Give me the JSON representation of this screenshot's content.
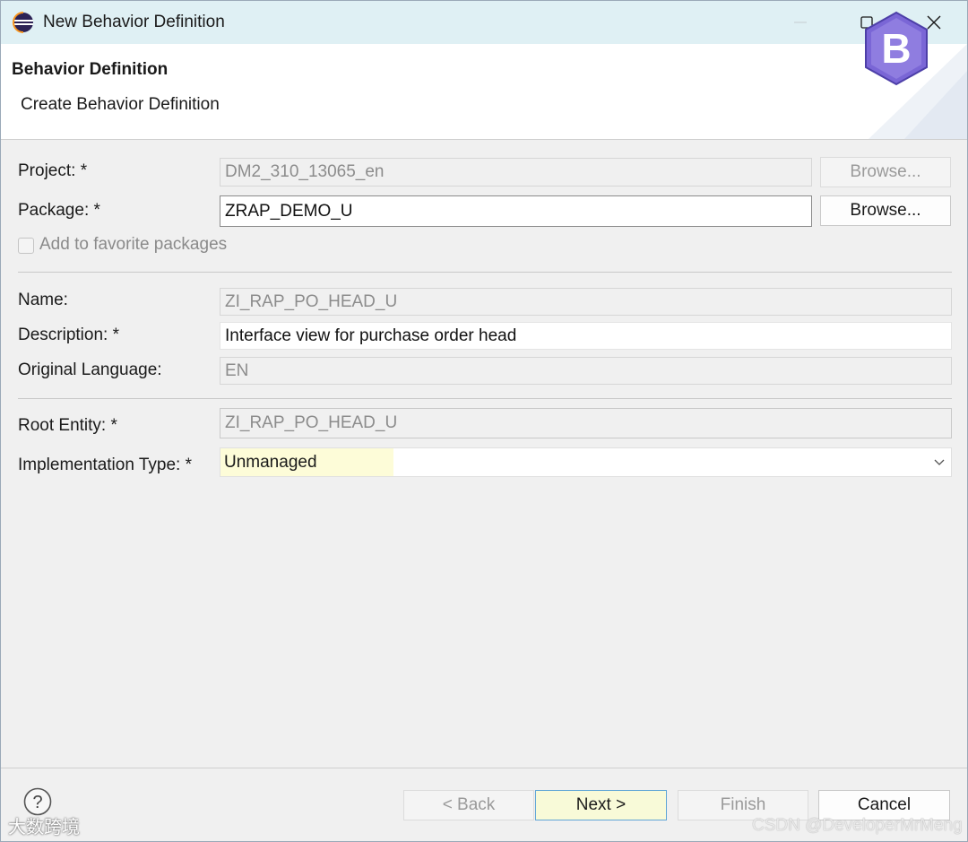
{
  "window": {
    "title": "New Behavior Definition",
    "icon": "eclipse-icon"
  },
  "banner": {
    "title": "Behavior Definition",
    "description": "Create Behavior Definition",
    "logo_letter": "B",
    "accent": "#6a52c4"
  },
  "form": {
    "project": {
      "label": "Project: *",
      "value": "DM2_310_13065_en",
      "browse": "Browse..."
    },
    "package": {
      "label": "Package: *",
      "value": "ZRAP_DEMO_U",
      "browse": "Browse..."
    },
    "favorite": {
      "label": "Add to favorite packages",
      "checked": false
    },
    "name": {
      "label": "Name:",
      "value": "ZI_RAP_PO_HEAD_U"
    },
    "description": {
      "label": "Description: *",
      "value": "Interface view for purchase order head"
    },
    "original_language": {
      "label": "Original Language:",
      "value": "EN"
    },
    "root_entity": {
      "label": "Root Entity: *",
      "value": "ZI_RAP_PO_HEAD_U"
    },
    "implementation_type": {
      "label": "Implementation Type: *",
      "value": "Unmanaged"
    }
  },
  "footer": {
    "back": "< Back",
    "next": "Next >",
    "finish": "Finish",
    "cancel": "Cancel"
  },
  "watermarks": {
    "left": "大数跨境",
    "right": "CSDN @DeveloperMrMeng"
  }
}
